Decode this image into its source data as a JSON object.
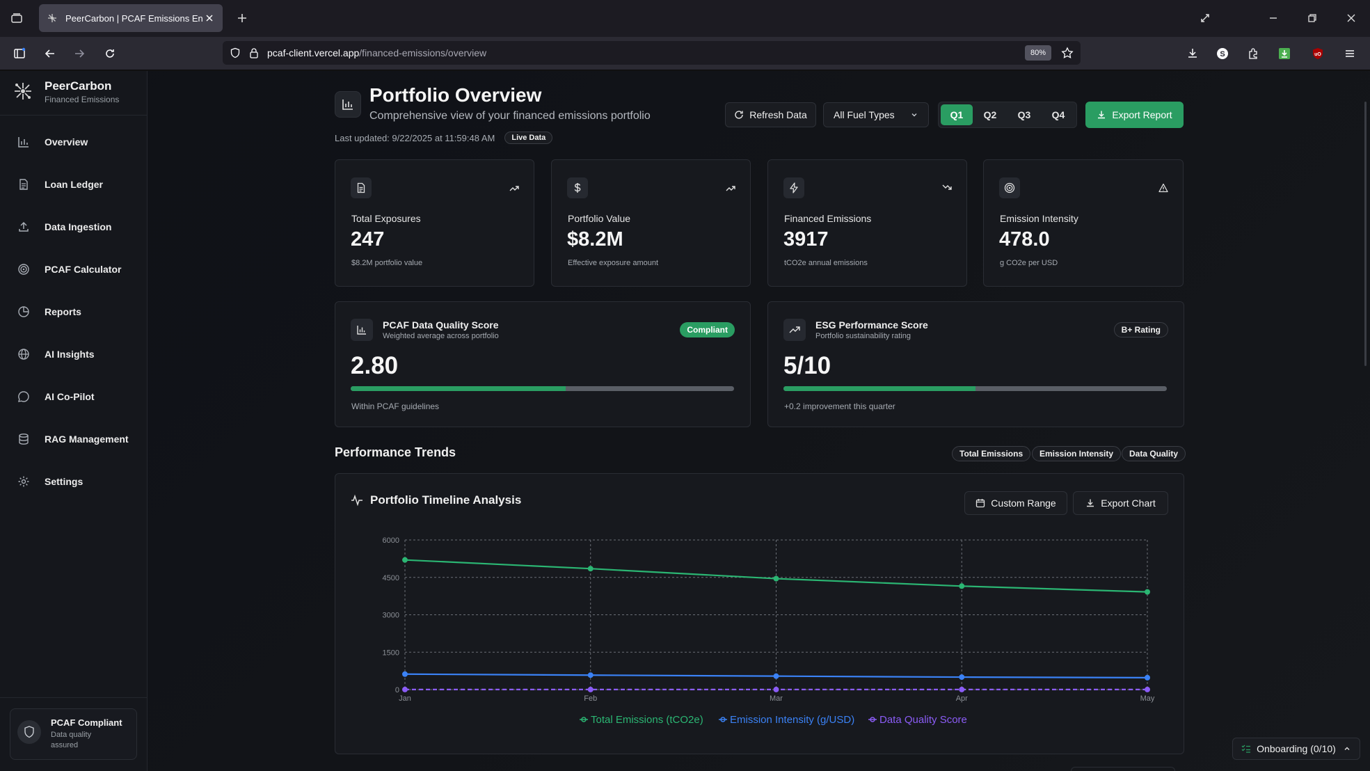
{
  "browser": {
    "tab_title": "PeerCarbon | PCAF Emissions Engine",
    "url_host": "pcaf-client.vercel.app",
    "url_path": "/financed-emissions/overview",
    "zoom": "80%"
  },
  "sidebar": {
    "brand_name": "PeerCarbon",
    "brand_sub": "Financed Emissions",
    "items": [
      {
        "label": "Overview",
        "icon": "chart-bar-icon"
      },
      {
        "label": "Loan Ledger",
        "icon": "document-icon"
      },
      {
        "label": "Data Ingestion",
        "icon": "upload-icon"
      },
      {
        "label": "PCAF Calculator",
        "icon": "target-icon"
      },
      {
        "label": "Reports",
        "icon": "pie-chart-icon"
      },
      {
        "label": "AI Insights",
        "icon": "globe-icon"
      },
      {
        "label": "AI Co-Pilot",
        "icon": "chat-icon"
      },
      {
        "label": "RAG Management",
        "icon": "database-icon"
      },
      {
        "label": "Settings",
        "icon": "gear-icon"
      }
    ],
    "compliance_title": "PCAF Compliant",
    "compliance_sub": "Data quality assured"
  },
  "header": {
    "title": "Portfolio Overview",
    "subtitle": "Comprehensive view of your financed emissions portfolio",
    "last_updated": "Last updated: 9/22/2025 at 11:59:48 AM",
    "live_badge": "Live Data",
    "refresh_label": "Refresh Data",
    "fuel_select": "All Fuel Types",
    "quarters": [
      "Q1",
      "Q2",
      "Q3",
      "Q4"
    ],
    "active_quarter": "Q1",
    "export_label": "Export Report"
  },
  "stats": [
    {
      "label": "Total Exposures",
      "value": "247",
      "sub": "$8.2M portfolio value",
      "icon": "document-icon",
      "trend": "trend-up-icon"
    },
    {
      "label": "Portfolio Value",
      "value": "$8.2M",
      "sub": "Effective exposure amount",
      "icon": "dollar-icon",
      "trend": "trend-up-icon"
    },
    {
      "label": "Financed Emissions",
      "value": "3917",
      "sub": "tCO2e annual emissions",
      "icon": "lightning-icon",
      "trend": "trend-down-icon"
    },
    {
      "label": "Emission Intensity",
      "value": "478.0",
      "sub": "g CO2e per USD",
      "icon": "target-icon",
      "trend": "warning-icon"
    }
  ],
  "scores": [
    {
      "label": "PCAF Data Quality Score",
      "sublabel": "Weighted average across portfolio",
      "value": "2.80",
      "badge": "Compliant",
      "progress": 0.56,
      "foot": "Within PCAF guidelines"
    },
    {
      "label": "ESG Performance Score",
      "sublabel": "Portfolio sustainability rating",
      "value": "5/10",
      "badge": "B+ Rating",
      "progress": 0.5,
      "foot": "+0.2 improvement this quarter"
    }
  ],
  "trends": {
    "title": "Performance Trends",
    "chips": [
      "Total Emissions",
      "Emission Intensity",
      "Data Quality"
    ],
    "chart_title": "Portfolio Timeline Analysis",
    "custom_range": "Custom Range",
    "export_chart": "Export Chart"
  },
  "chart_data": {
    "type": "line",
    "x": [
      "Jan",
      "Feb",
      "Mar",
      "Apr",
      "May"
    ],
    "ylim": [
      0,
      6000
    ],
    "yticks": [
      "0",
      "1500",
      "3000",
      "4500",
      "6000"
    ],
    "grid": true,
    "legend_position": "bottom-center",
    "series": [
      {
        "name": "Total Emissions (tCO2e)",
        "color": "#2bb673",
        "values": [
          5200,
          4850,
          4450,
          4150,
          3917
        ],
        "dashed": false
      },
      {
        "name": "Emission Intensity (g/USD)",
        "color": "#3b82f6",
        "values": [
          620,
          580,
          540,
          500,
          478
        ],
        "dashed": false
      },
      {
        "name": "Data Quality Score",
        "color": "#8b5cf6",
        "values": [
          2.9,
          2.9,
          2.85,
          2.82,
          2.8
        ],
        "dashed": true
      }
    ]
  },
  "onboarding": "Onboarding (0/10)",
  "colors": {
    "accent": "#2a9d62",
    "background": "#121418"
  }
}
